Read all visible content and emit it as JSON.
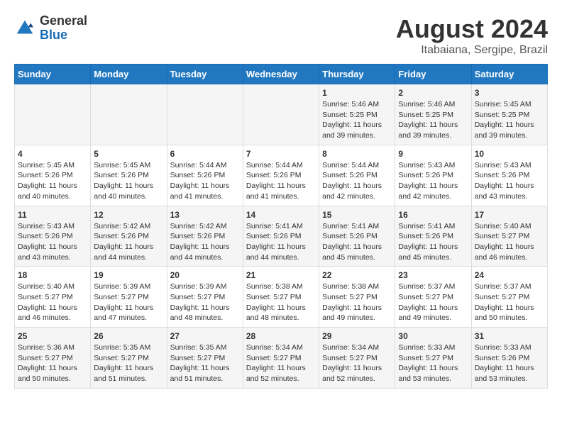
{
  "logo": {
    "general": "General",
    "blue": "Blue"
  },
  "title": {
    "month_year": "August 2024",
    "location": "Itabaiana, Sergipe, Brazil"
  },
  "headers": [
    "Sunday",
    "Monday",
    "Tuesday",
    "Wednesday",
    "Thursday",
    "Friday",
    "Saturday"
  ],
  "weeks": [
    [
      {
        "day": "",
        "info": ""
      },
      {
        "day": "",
        "info": ""
      },
      {
        "day": "",
        "info": ""
      },
      {
        "day": "",
        "info": ""
      },
      {
        "day": "1",
        "info": "Sunrise: 5:46 AM\nSunset: 5:25 PM\nDaylight: 11 hours and 39 minutes."
      },
      {
        "day": "2",
        "info": "Sunrise: 5:46 AM\nSunset: 5:25 PM\nDaylight: 11 hours and 39 minutes."
      },
      {
        "day": "3",
        "info": "Sunrise: 5:45 AM\nSunset: 5:25 PM\nDaylight: 11 hours and 39 minutes."
      }
    ],
    [
      {
        "day": "4",
        "info": "Sunrise: 5:45 AM\nSunset: 5:26 PM\nDaylight: 11 hours and 40 minutes."
      },
      {
        "day": "5",
        "info": "Sunrise: 5:45 AM\nSunset: 5:26 PM\nDaylight: 11 hours and 40 minutes."
      },
      {
        "day": "6",
        "info": "Sunrise: 5:44 AM\nSunset: 5:26 PM\nDaylight: 11 hours and 41 minutes."
      },
      {
        "day": "7",
        "info": "Sunrise: 5:44 AM\nSunset: 5:26 PM\nDaylight: 11 hours and 41 minutes."
      },
      {
        "day": "8",
        "info": "Sunrise: 5:44 AM\nSunset: 5:26 PM\nDaylight: 11 hours and 42 minutes."
      },
      {
        "day": "9",
        "info": "Sunrise: 5:43 AM\nSunset: 5:26 PM\nDaylight: 11 hours and 42 minutes."
      },
      {
        "day": "10",
        "info": "Sunrise: 5:43 AM\nSunset: 5:26 PM\nDaylight: 11 hours and 43 minutes."
      }
    ],
    [
      {
        "day": "11",
        "info": "Sunrise: 5:43 AM\nSunset: 5:26 PM\nDaylight: 11 hours and 43 minutes."
      },
      {
        "day": "12",
        "info": "Sunrise: 5:42 AM\nSunset: 5:26 PM\nDaylight: 11 hours and 44 minutes."
      },
      {
        "day": "13",
        "info": "Sunrise: 5:42 AM\nSunset: 5:26 PM\nDaylight: 11 hours and 44 minutes."
      },
      {
        "day": "14",
        "info": "Sunrise: 5:41 AM\nSunset: 5:26 PM\nDaylight: 11 hours and 44 minutes."
      },
      {
        "day": "15",
        "info": "Sunrise: 5:41 AM\nSunset: 5:26 PM\nDaylight: 11 hours and 45 minutes."
      },
      {
        "day": "16",
        "info": "Sunrise: 5:41 AM\nSunset: 5:26 PM\nDaylight: 11 hours and 45 minutes."
      },
      {
        "day": "17",
        "info": "Sunrise: 5:40 AM\nSunset: 5:27 PM\nDaylight: 11 hours and 46 minutes."
      }
    ],
    [
      {
        "day": "18",
        "info": "Sunrise: 5:40 AM\nSunset: 5:27 PM\nDaylight: 11 hours and 46 minutes."
      },
      {
        "day": "19",
        "info": "Sunrise: 5:39 AM\nSunset: 5:27 PM\nDaylight: 11 hours and 47 minutes."
      },
      {
        "day": "20",
        "info": "Sunrise: 5:39 AM\nSunset: 5:27 PM\nDaylight: 11 hours and 48 minutes."
      },
      {
        "day": "21",
        "info": "Sunrise: 5:38 AM\nSunset: 5:27 PM\nDaylight: 11 hours and 48 minutes."
      },
      {
        "day": "22",
        "info": "Sunrise: 5:38 AM\nSunset: 5:27 PM\nDaylight: 11 hours and 49 minutes."
      },
      {
        "day": "23",
        "info": "Sunrise: 5:37 AM\nSunset: 5:27 PM\nDaylight: 11 hours and 49 minutes."
      },
      {
        "day": "24",
        "info": "Sunrise: 5:37 AM\nSunset: 5:27 PM\nDaylight: 11 hours and 50 minutes."
      }
    ],
    [
      {
        "day": "25",
        "info": "Sunrise: 5:36 AM\nSunset: 5:27 PM\nDaylight: 11 hours and 50 minutes."
      },
      {
        "day": "26",
        "info": "Sunrise: 5:35 AM\nSunset: 5:27 PM\nDaylight: 11 hours and 51 minutes."
      },
      {
        "day": "27",
        "info": "Sunrise: 5:35 AM\nSunset: 5:27 PM\nDaylight: 11 hours and 51 minutes."
      },
      {
        "day": "28",
        "info": "Sunrise: 5:34 AM\nSunset: 5:27 PM\nDaylight: 11 hours and 52 minutes."
      },
      {
        "day": "29",
        "info": "Sunrise: 5:34 AM\nSunset: 5:27 PM\nDaylight: 11 hours and 52 minutes."
      },
      {
        "day": "30",
        "info": "Sunrise: 5:33 AM\nSunset: 5:27 PM\nDaylight: 11 hours and 53 minutes."
      },
      {
        "day": "31",
        "info": "Sunrise: 5:33 AM\nSunset: 5:26 PM\nDaylight: 11 hours and 53 minutes."
      }
    ]
  ]
}
